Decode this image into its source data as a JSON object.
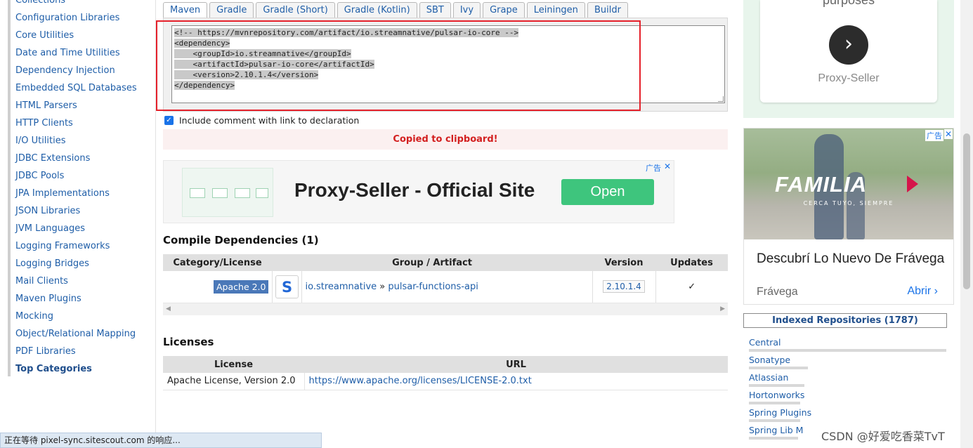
{
  "sidebar": {
    "items": [
      "Collections",
      "Configuration Libraries",
      "Core Utilities",
      "Date and Time Utilities",
      "Dependency Injection",
      "Embedded SQL Databases",
      "HTML Parsers",
      "HTTP Clients",
      "I/O Utilities",
      "JDBC Extensions",
      "JDBC Pools",
      "JPA Implementations",
      "JSON Libraries",
      "JVM Languages",
      "Logging Frameworks",
      "Logging Bridges",
      "Mail Clients",
      "Maven Plugins",
      "Mocking",
      "Object/Relational Mapping",
      "PDF Libraries"
    ],
    "top_categories": "Top Categories"
  },
  "tabs": [
    "Maven",
    "Gradle",
    "Gradle (Short)",
    "Gradle (Kotlin)",
    "SBT",
    "Ivy",
    "Grape",
    "Leiningen",
    "Buildr"
  ],
  "snippet": {
    "lines": [
      "<!-- https://mvnrepository.com/artifact/io.streamnative/pulsar-io-core -->",
      "<dependency>",
      "    <groupId>io.streamnative</groupId>",
      "    <artifactId>pulsar-io-core</artifactId>",
      "    <version>2.10.1.4</version>",
      "</dependency>"
    ]
  },
  "include_comment": {
    "label": "Include comment with link to declaration",
    "checked": true,
    "check_glyph": "✓"
  },
  "copied_message": "Copied to clipboard!",
  "ad_banner": {
    "headline": "Proxy-Seller - Official Site",
    "button": "Open",
    "ad_label": "广告",
    "close": "✕"
  },
  "compile_deps": {
    "title": "Compile Dependencies (1)",
    "headers": [
      "Category/License",
      "Group / Artifact",
      "Version",
      "Updates"
    ],
    "row": {
      "license": "Apache 2.0",
      "group": "io.streamnative",
      "separator": "»",
      "artifact": "pulsar-functions-api",
      "version": "2.10.1.4",
      "updates": "✓"
    },
    "scroll_left": "◀",
    "scroll_right": "▶"
  },
  "licenses": {
    "title": "Licenses",
    "headers": [
      "License",
      "URL"
    ],
    "row": {
      "license": "Apache License, Version 2.0",
      "url": "https://www.apache.org/licenses/LICENSE-2.0.txt"
    }
  },
  "right_ad_top": {
    "text": "purposes",
    "arrow": "›",
    "brand": "Proxy-Seller"
  },
  "right_ad_bottom": {
    "logo": "FAMILIA",
    "tagline": "CERCA TUYO, SIEMPRE",
    "title": "Descubrí Lo Nuevo De Frávega",
    "advertiser": "Frávega",
    "cta": "Abrir ›",
    "ad_label": "广告",
    "close": "✕"
  },
  "indexed_repos": {
    "title": "Indexed Repositories (1787)",
    "items": [
      {
        "name": "Central",
        "share": 1.0
      },
      {
        "name": "Sonatype",
        "share": 0.3
      },
      {
        "name": "Atlassian",
        "share": 0.28
      },
      {
        "name": "Hortonworks",
        "share": 0.26
      },
      {
        "name": "Spring Plugins",
        "share": 0.26
      },
      {
        "name": "Spring Lib M",
        "share": 0.25
      }
    ]
  },
  "status_bar": "正在等待 pixel-sync.sitescout.com 的响应...",
  "watermark": "CSDN @好爱吃香菜TvT"
}
